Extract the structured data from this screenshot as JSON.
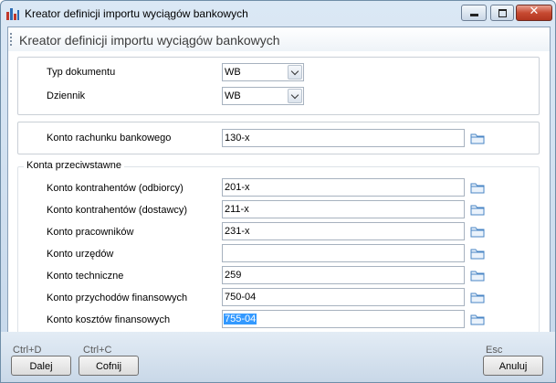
{
  "window": {
    "title": "Kreator definicji importu wyciągów bankowych",
    "icon": "bar-chart-icon",
    "controls": [
      "minimize-icon",
      "maximize-icon",
      "close-icon"
    ],
    "close_glyph": "✕"
  },
  "header": {
    "title": "Kreator definicji importu wyciągów bankowych"
  },
  "document_group": {
    "doc_type": {
      "label": "Typ dokumentu",
      "value": "WB"
    },
    "journal": {
      "label": "Dziennik",
      "value": "WB"
    }
  },
  "bank_account": {
    "label": "Konto rachunku bankowego",
    "value": "130-x"
  },
  "offset_accounts": {
    "legend": "Konta przeciwstawne",
    "rows": [
      {
        "label": "Konto kontrahentów (odbiorcy)",
        "value": "201-x",
        "selected": false
      },
      {
        "label": "Konto kontrahentów (dostawcy)",
        "value": "211-x",
        "selected": false
      },
      {
        "label": "Konto pracowników",
        "value": "231-x",
        "selected": false
      },
      {
        "label": "Konto urzędów",
        "value": "",
        "selected": false
      },
      {
        "label": "Konto techniczne",
        "value": "259",
        "selected": false
      },
      {
        "label": "Konto przychodów finansowych",
        "value": "750-04",
        "selected": false
      },
      {
        "label": "Konto kosztów finansowych",
        "value": "755-04",
        "selected": true
      }
    ]
  },
  "footer": {
    "next": {
      "label": "Dalej",
      "shortcut": "Ctrl+D"
    },
    "back": {
      "label": "Cofnij",
      "shortcut": "Ctrl+C"
    },
    "cancel": {
      "label": "Anuluj",
      "shortcut": "Esc"
    }
  },
  "colors": {
    "selection": "#3399ff",
    "folder": "#4a86c5",
    "title_band": "#dbe8f5"
  }
}
